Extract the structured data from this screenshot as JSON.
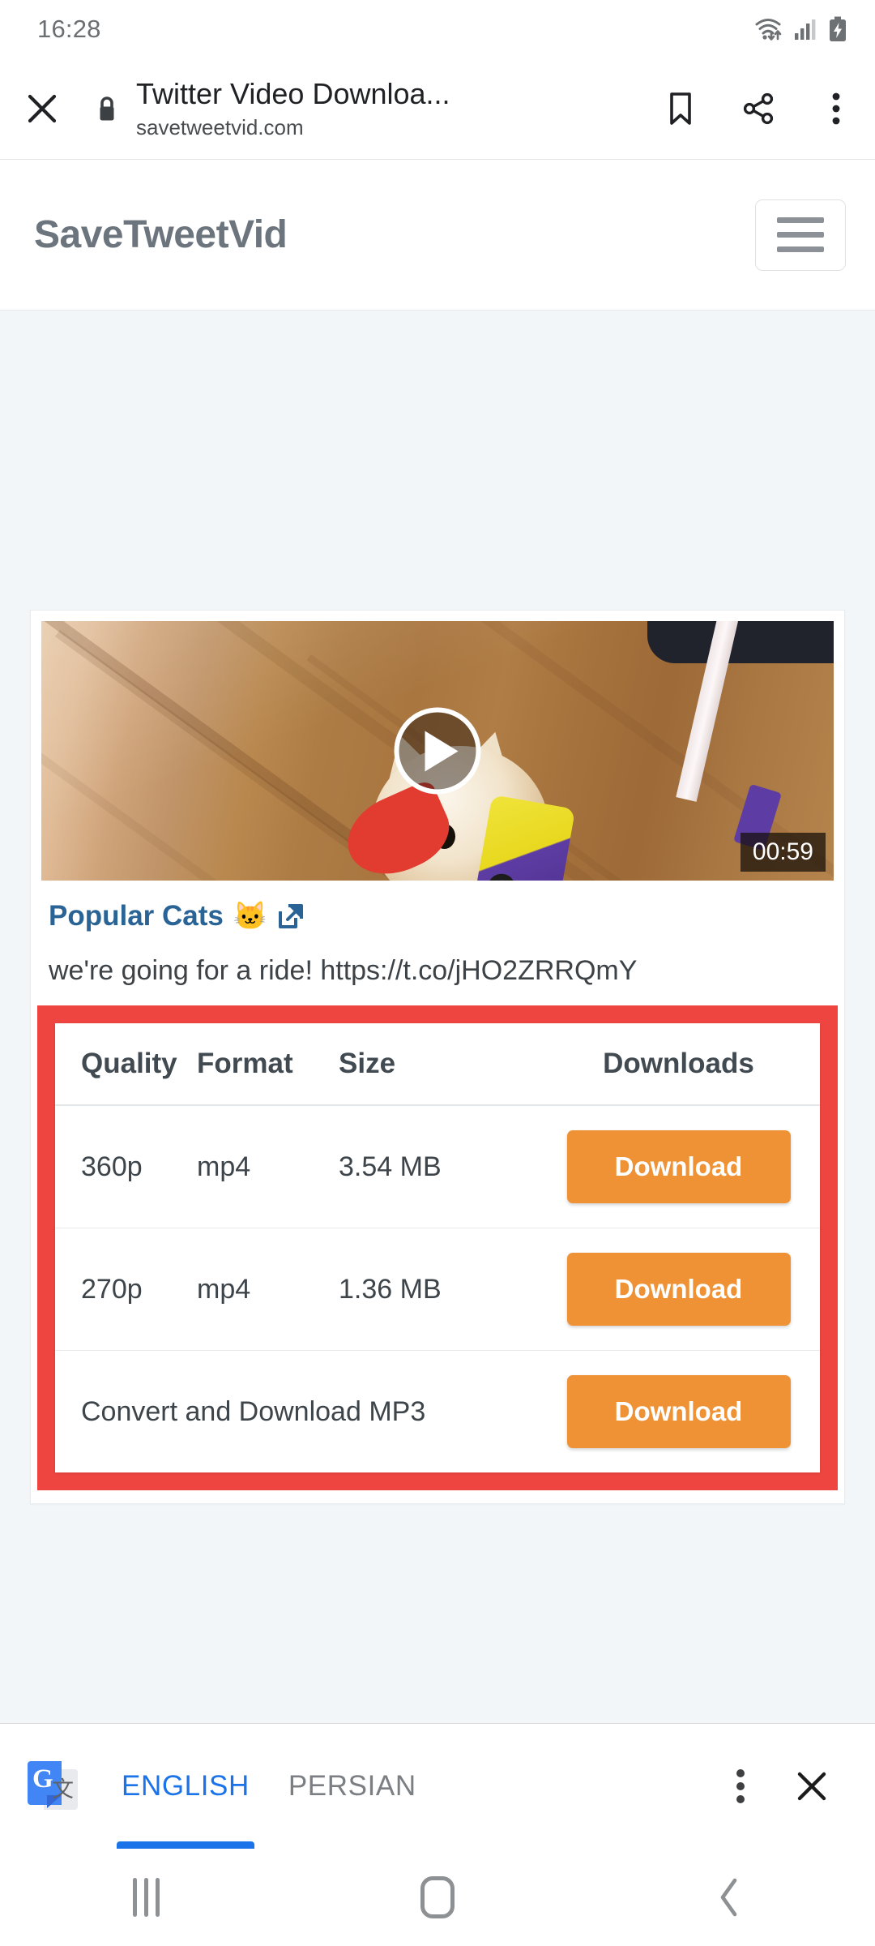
{
  "status_bar": {
    "time": "16:28",
    "icons": [
      "wifi-data-icon",
      "cellular-signal-icon",
      "battery-charging-icon"
    ]
  },
  "browser_toolbar": {
    "close_icon": "close-icon",
    "lock_icon": "lock-icon",
    "page_title": "Twitter Video Downloa...",
    "page_url": "savetweetvid.com",
    "bookmark_icon": "bookmark-icon",
    "share_icon": "share-icon",
    "overflow_icon": "more-vertical-icon"
  },
  "site_header": {
    "brand": "SaveTweetVid",
    "menu_icon": "hamburger-menu-icon"
  },
  "video": {
    "play_icon": "play-icon",
    "duration": "00:59",
    "title": "Popular Cats",
    "title_emoji": "🐱",
    "external_link_icon": "external-link-icon",
    "tweet_text": "we're going for a ride! https://t.co/jHO2ZRRQmY"
  },
  "download_table": {
    "headers": [
      "Quality",
      "Format",
      "Size",
      "Downloads"
    ],
    "rows": [
      {
        "quality": "360p",
        "format": "mp4",
        "size": "3.54 MB",
        "button": "Download"
      },
      {
        "quality": "270p",
        "format": "mp4",
        "size": "1.36 MB",
        "button": "Download"
      }
    ],
    "mp3_row": {
      "label": "Convert and Download MP3",
      "button": "Download"
    },
    "border_color": "#ef4540",
    "button_color": "#ef9235"
  },
  "translate_bar": {
    "icon": "google-translate-icon",
    "source_language": "ENGLISH",
    "target_language": "PERSIAN",
    "overflow_icon": "more-vertical-icon",
    "close_icon": "close-icon",
    "active_color": "#1a73e8"
  },
  "navigation_bar": {
    "recents_icon": "recents-icon",
    "home_icon": "home-icon",
    "back_icon": "back-icon"
  }
}
